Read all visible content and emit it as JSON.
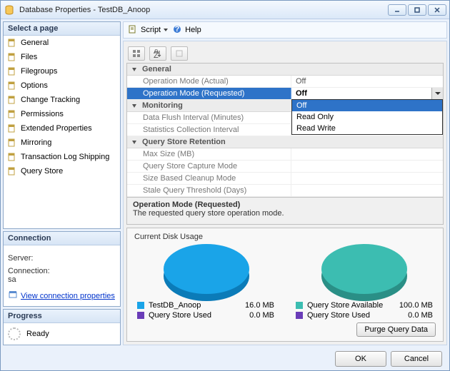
{
  "window": {
    "title": "Database Properties - TestDB_Anoop"
  },
  "sidebar": {
    "header": "Select a page",
    "items": [
      {
        "label": "General"
      },
      {
        "label": "Files"
      },
      {
        "label": "Filegroups"
      },
      {
        "label": "Options"
      },
      {
        "label": "Change Tracking"
      },
      {
        "label": "Permissions"
      },
      {
        "label": "Extended Properties"
      },
      {
        "label": "Mirroring"
      },
      {
        "label": "Transaction Log Shipping"
      },
      {
        "label": "Query Store"
      }
    ]
  },
  "connection": {
    "header": "Connection",
    "server_label": "Server:",
    "server_value": "",
    "conn_label": "Connection:",
    "conn_value": "sa",
    "link": "View connection properties"
  },
  "progress": {
    "header": "Progress",
    "status": "Ready"
  },
  "toolbar": {
    "script": "Script",
    "help": "Help"
  },
  "propgrid": {
    "cats": [
      {
        "name": "General",
        "rows": [
          {
            "k": "Operation Mode (Actual)",
            "v": "Off"
          },
          {
            "k": "Operation Mode (Requested)",
            "v": "Off",
            "selected": true,
            "options": [
              "Off",
              "Read Only",
              "Read Write"
            ],
            "sel_opt": 0
          }
        ]
      },
      {
        "name": "Monitoring",
        "rows": [
          {
            "k": "Data Flush Interval (Minutes)",
            "v": ""
          },
          {
            "k": "Statistics Collection Interval",
            "v": ""
          }
        ]
      },
      {
        "name": "Query Store Retention",
        "rows": [
          {
            "k": "Max Size (MB)",
            "v": ""
          },
          {
            "k": "Query Store Capture Mode",
            "v": ""
          },
          {
            "k": "Size Based Cleanup Mode",
            "v": ""
          },
          {
            "k": "Stale Query Threshold (Days)",
            "v": ""
          }
        ]
      }
    ]
  },
  "help": {
    "title": "Operation Mode (Requested)",
    "desc": "The requested query store operation mode."
  },
  "disk": {
    "title": "Current Disk Usage",
    "purge": "Purge Query Data",
    "left_legend": [
      {
        "color": "#1aa4e8",
        "label": "TestDB_Anoop",
        "value": "16.0 MB"
      },
      {
        "color": "#6a3db8",
        "label": "Query Store Used",
        "value": "0.0 MB"
      }
    ],
    "right_legend": [
      {
        "color": "#3cbdb1",
        "label": "Query Store Available",
        "value": "100.0 MB"
      },
      {
        "color": "#6a3db8",
        "label": "Query Store Used",
        "value": "0.0 MB"
      }
    ]
  },
  "chart_data": [
    {
      "type": "pie",
      "title": "TestDB_Anoop disk usage",
      "series": [
        {
          "name": "TestDB_Anoop",
          "value": 16.0,
          "unit": "MB",
          "color": "#1aa4e8"
        },
        {
          "name": "Query Store Used",
          "value": 0.0,
          "unit": "MB",
          "color": "#6a3db8"
        }
      ]
    },
    {
      "type": "pie",
      "title": "Query Store disk usage",
      "series": [
        {
          "name": "Query Store Available",
          "value": 100.0,
          "unit": "MB",
          "color": "#3cbdb1"
        },
        {
          "name": "Query Store Used",
          "value": 0.0,
          "unit": "MB",
          "color": "#6a3db8"
        }
      ]
    }
  ],
  "footer": {
    "ok": "OK",
    "cancel": "Cancel"
  }
}
